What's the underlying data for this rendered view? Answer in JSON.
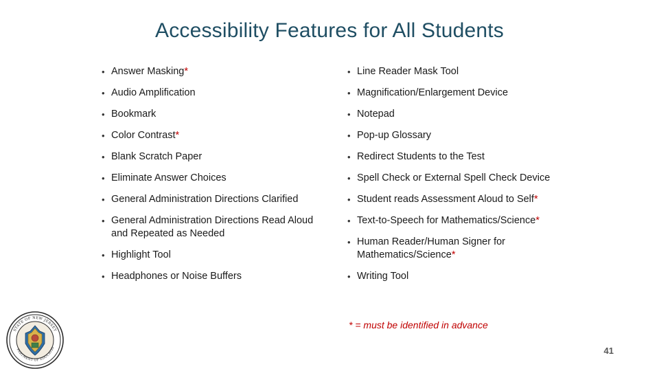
{
  "slide": {
    "title": "Accessibility Features for All Students",
    "page_number": "41",
    "footnote": "* = must be identified in advance",
    "footnote_star": "*",
    "footnote_rest": " = must be identified in advance",
    "left_column": [
      {
        "text": "Answer Masking",
        "star": true
      },
      {
        "text": "Audio Amplification",
        "star": false
      },
      {
        "text": "Bookmark",
        "star": false
      },
      {
        "text": "Color Contrast",
        "star": true
      },
      {
        "text": "Blank Scratch Paper",
        "star": false
      },
      {
        "text": "Eliminate Answer Choices",
        "star": false
      },
      {
        "text": "General Administration Directions Clarified",
        "star": false
      },
      {
        "text": "General Administration Directions Read Aloud and Repeated as Needed",
        "star": false
      },
      {
        "text": "Highlight Tool",
        "star": false
      },
      {
        "text": "Headphones or Noise Buffers",
        "star": false
      }
    ],
    "right_column": [
      {
        "text": "Line Reader Mask Tool",
        "star": false
      },
      {
        "text": "Magnification/Enlargement Device",
        "star": false
      },
      {
        "text": "Notepad",
        "star": false
      },
      {
        "text": "Pop-up Glossary",
        "star": false
      },
      {
        "text": "Redirect Students to the Test",
        "star": false
      },
      {
        "text": "Spell Check or External Spell Check Device",
        "star": false
      },
      {
        "text": "Student reads Assessment Aloud to Self",
        "star": true
      },
      {
        "text": "Text-to-Speech for Mathematics/Science",
        "star": true
      },
      {
        "text": "Human Reader/Human Signer for Mathematics/Science",
        "star": true
      },
      {
        "text": "Writing Tool",
        "star": false
      }
    ],
    "bullet_glyph": "•",
    "seal": {
      "name": "nj-department-of-education-seal",
      "top_text": "STATE OF NEW JERSEY",
      "bottom_text": "DEPARTMENT OF EDUCATION"
    },
    "colors": {
      "title": "#1f4e63",
      "star": "#c00000",
      "text": "#1a1a1a",
      "page_number": "#595959"
    }
  }
}
